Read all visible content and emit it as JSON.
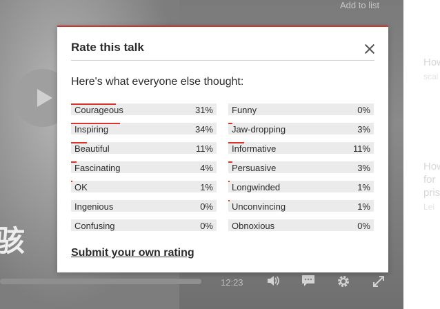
{
  "player": {
    "add_to_list": "Add to list",
    "overlay_char": "骇",
    "time": "12:23",
    "controls": [
      "volume-icon",
      "subtitles-icon",
      "settings-gear-icon",
      "fullscreen-icon"
    ],
    "play_icon": "play-icon"
  },
  "sidebar": {
    "item1_title": "How",
    "item1_sub": "scal",
    "item2_line1": "How",
    "item2_line2": "for",
    "item2_line3": "pris",
    "item2_sub": "Lei"
  },
  "modal": {
    "title": "Rate this talk",
    "subtitle": "Here's what everyone else thought:",
    "submit": "Submit your own rating",
    "accent_color": "#d8342b",
    "left_ratings": [
      {
        "label": "Courageous",
        "pct_text": "31%",
        "value": 31
      },
      {
        "label": "Inspiring",
        "pct_text": "34%",
        "value": 34
      },
      {
        "label": "Beautiful",
        "pct_text": "11%",
        "value": 11
      },
      {
        "label": "Fascinating",
        "pct_text": "4%",
        "value": 4
      },
      {
        "label": "OK",
        "pct_text": "1%",
        "value": 1
      },
      {
        "label": "Ingenious",
        "pct_text": "0%",
        "value": 0
      },
      {
        "label": "Confusing",
        "pct_text": "0%",
        "value": 0
      }
    ],
    "right_ratings": [
      {
        "label": "Funny",
        "pct_text": "0%",
        "value": 0
      },
      {
        "label": "Jaw-dropping",
        "pct_text": "3%",
        "value": 3
      },
      {
        "label": "Informative",
        "pct_text": "11%",
        "value": 11
      },
      {
        "label": "Persuasive",
        "pct_text": "3%",
        "value": 3
      },
      {
        "label": "Longwinded",
        "pct_text": "1%",
        "value": 1
      },
      {
        "label": "Unconvincing",
        "pct_text": "1%",
        "value": 1
      },
      {
        "label": "Obnoxious",
        "pct_text": "0%",
        "value": 0
      }
    ]
  }
}
